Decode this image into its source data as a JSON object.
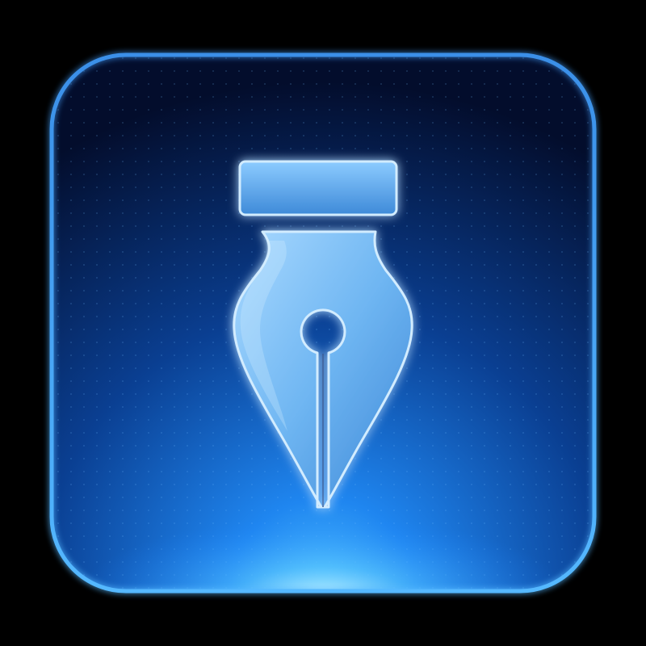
{
  "icon": {
    "name": "fountain-pen-nib-icon",
    "style": "glowing blue app icon"
  },
  "colors": {
    "background": "#000000",
    "tile_dark": "#030d2c",
    "tile_mid": "#0a3f92",
    "tile_bright": "#1f8cff",
    "border": "#3aa2ff",
    "glow": "#7fd3ff",
    "nib_light": "#a9d9ff",
    "nib_mid": "#5fa9ec",
    "nib_outline": "#d2ecff",
    "nib_slit": "#0d3a80"
  }
}
